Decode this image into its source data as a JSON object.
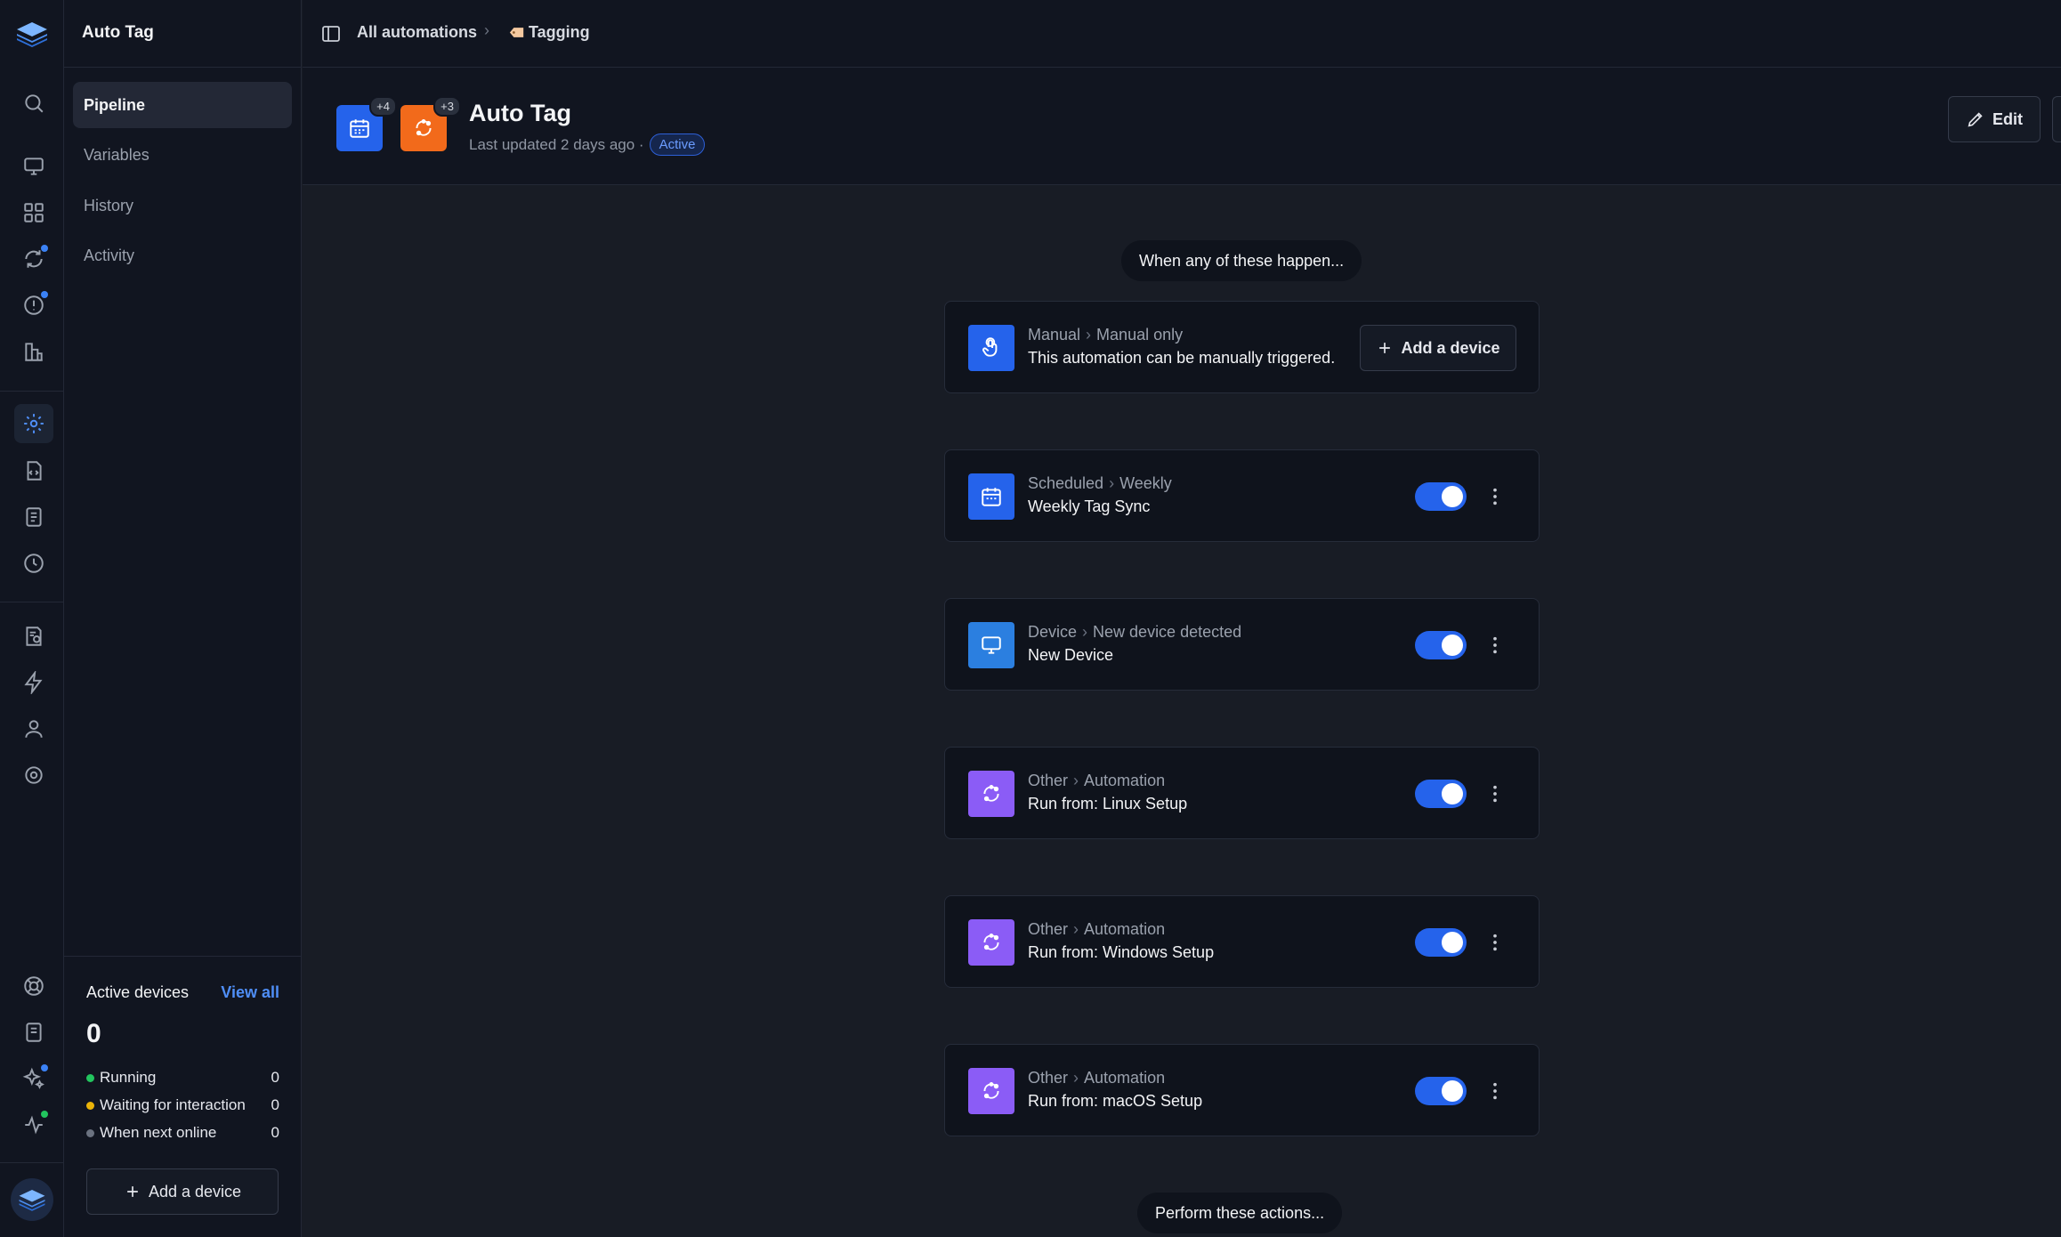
{
  "app": {
    "title": "Auto Tag"
  },
  "sidebar": {
    "items": [
      {
        "label": "Pipeline",
        "active": true
      },
      {
        "label": "Variables"
      },
      {
        "label": "History"
      },
      {
        "label": "Activity"
      }
    ],
    "active_devices": {
      "heading": "Active devices",
      "view_all": "View all",
      "count": "0",
      "rows": [
        {
          "label": "Running",
          "value": "0",
          "color": "#22c55e"
        },
        {
          "label": "Waiting for interaction",
          "value": "0",
          "color": "#eab308"
        },
        {
          "label": "When next online",
          "value": "0",
          "color": "#6b7280"
        }
      ],
      "add_button": "Add a device"
    }
  },
  "breadcrumb": {
    "parent": "All automations",
    "current": "Tagging",
    "current_icon": "label-tag-icon"
  },
  "header": {
    "title": "Auto Tag",
    "subtitle": "Last updated 2 days ago ·",
    "status": "Active",
    "badge_schedule_count": "+4",
    "badge_automation_count": "+3",
    "edit_label": "Edit"
  },
  "flow": {
    "trigger_heading": "When any of these happen...",
    "action_heading": "Perform these actions...",
    "manual": {
      "type": "Manual",
      "subtype": "Manual only",
      "name": "This automation can be manually triggered.",
      "button": "Add a device"
    },
    "triggers": [
      {
        "type": "Scheduled",
        "subtype": "Weekly",
        "name": "Weekly Tag Sync",
        "icon": "calendar-icon",
        "color": "#2563eb",
        "enabled": true
      },
      {
        "type": "Device",
        "subtype": "New device detected",
        "name": "New Device",
        "icon": "monitor-icon",
        "color": "#2b7fe0",
        "enabled": true
      },
      {
        "type": "Other",
        "subtype": "Automation",
        "name": "Run from: Linux Setup",
        "icon": "automation-icon",
        "color": "#8b5cf6",
        "enabled": true
      },
      {
        "type": "Other",
        "subtype": "Automation",
        "name": "Run from: Windows Setup",
        "icon": "automation-icon",
        "color": "#8b5cf6",
        "enabled": true
      },
      {
        "type": "Other",
        "subtype": "Automation",
        "name": "Run from: macOS Setup",
        "icon": "automation-icon",
        "color": "#8b5cf6",
        "enabled": true
      }
    ]
  },
  "colors": {
    "accent": "#2563eb",
    "orange": "#f26a1b",
    "purple": "#8b5cf6"
  }
}
